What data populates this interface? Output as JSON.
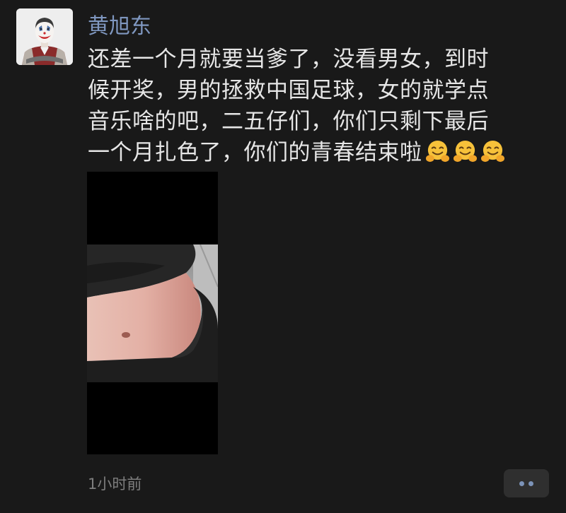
{
  "post": {
    "author": "黄旭东",
    "content_lines": [
      "还差一个月就要当爹了，没看男女，到时",
      "候开奖，男的拯救中国足球，女的就学点",
      "音乐啥的吧，二五仔们，你们只剩下最后",
      "一个月扎色了，你们的青春结束啦"
    ],
    "emoji": [
      "hugging-face",
      "hugging-face",
      "hugging-face"
    ],
    "photo_icon": "belly-photo",
    "timestamp": "1小时前",
    "more_icon": "two-dots"
  },
  "colors": {
    "background": "#191919",
    "author": "#7f97c0",
    "text": "#e6e6e6",
    "timestamp": "#7e7e7e",
    "more_button_bg": "#2f2f2f",
    "more_dots": "#7c93b8"
  }
}
